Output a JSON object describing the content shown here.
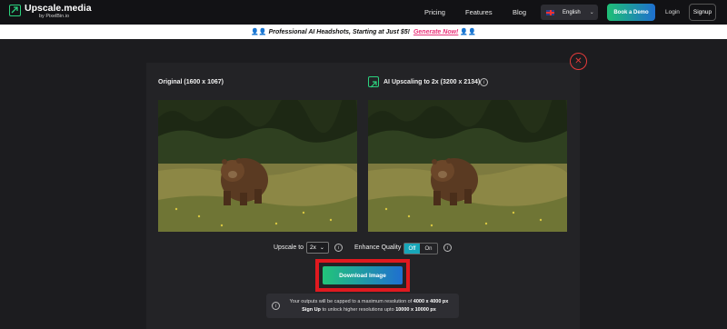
{
  "header": {
    "logo_name": "Upscale.media",
    "logo_sub": "by PixelBin.io",
    "nav": [
      "Pricing",
      "Features",
      "Blog"
    ],
    "language": "English",
    "book_demo": "Book a Demo",
    "login": "Login",
    "signup": "Signup"
  },
  "banner": {
    "text": "Professional AI Headshots, Starting at Just $5!",
    "cta": "Generate Now!"
  },
  "comparison": {
    "original_label": "Original (1600 x 1067)",
    "upscaled_label": "AI Upscaling to 2x (3200 x 2134)"
  },
  "controls": {
    "upscale_label": "Upscale to",
    "upscale_value": "2x",
    "enhance_label": "Enhance Quality",
    "toggle_off": "Off",
    "toggle_on": "On",
    "download": "Download Image"
  },
  "notice": {
    "line1_prefix": "Your outputs will be capped to a maximum resolution of",
    "line1_value": "4000 x 4000 px",
    "line2_link": "Sign Up",
    "line2_middle": "to unlock higher resolutions upto",
    "line2_value": "10000 x 10000 px"
  },
  "colors": {
    "accent_green": "#22c47a",
    "accent_blue": "#1f6fd0",
    "highlight_red": "#e0191f",
    "banner_link": "#e9327a"
  }
}
